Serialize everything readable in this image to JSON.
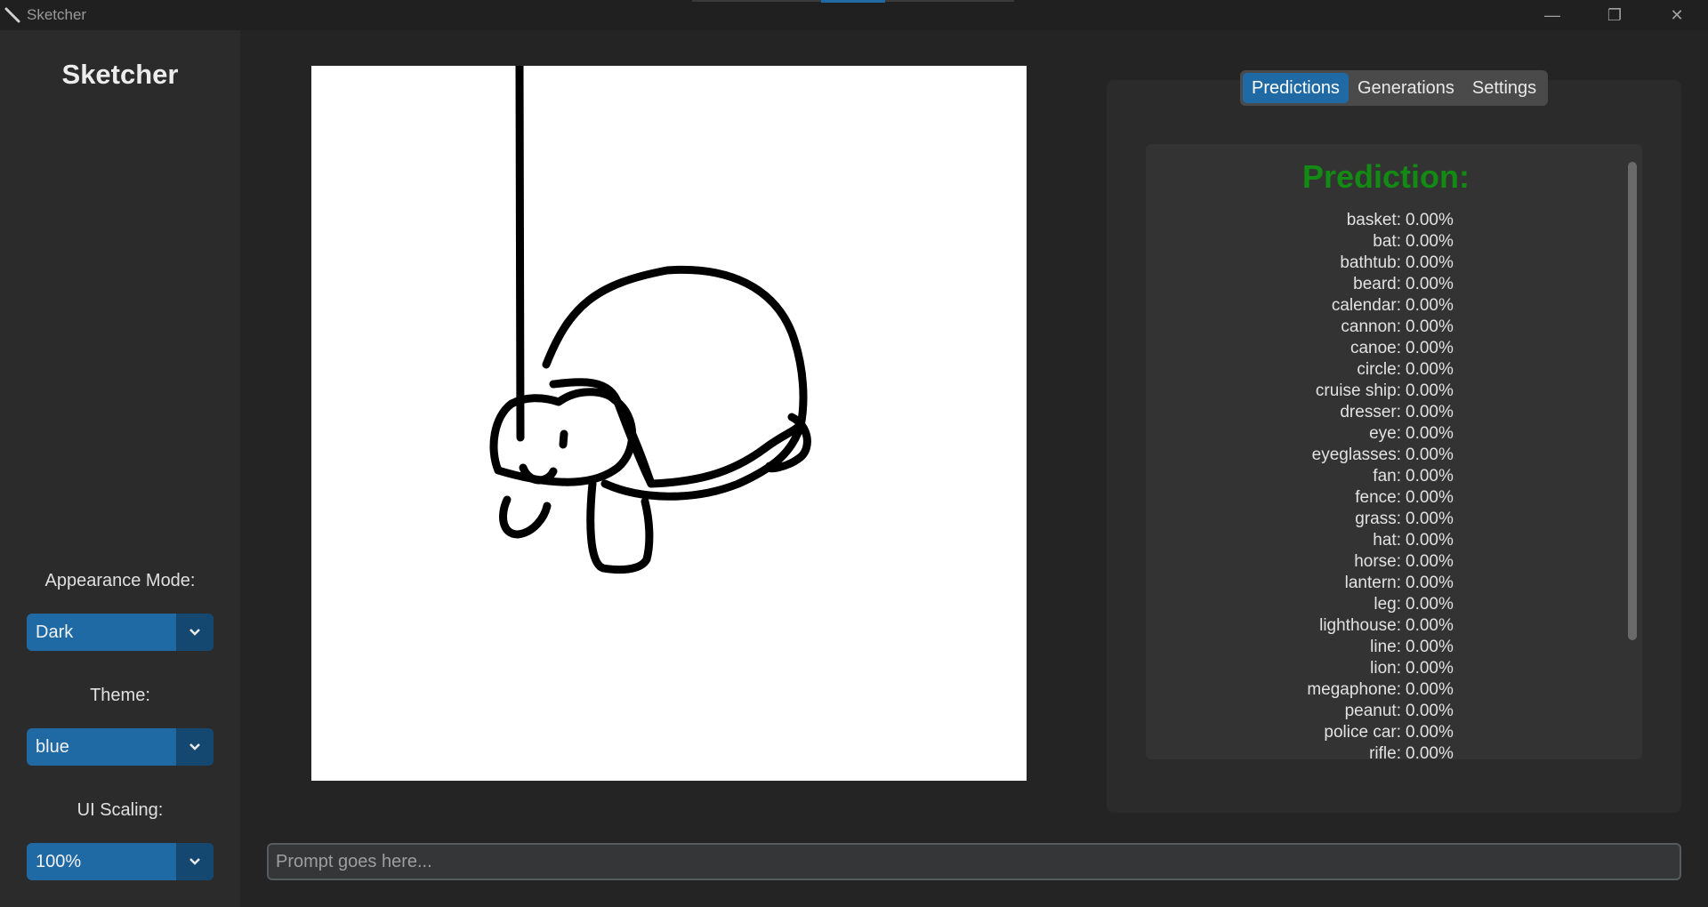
{
  "window": {
    "title": "Sketcher",
    "controls": {
      "minimize": "—",
      "restore": "❐",
      "close": "✕"
    }
  },
  "sidebar": {
    "logo": "Sketcher",
    "appearance": {
      "label": "Appearance Mode:",
      "value": "Dark"
    },
    "theme": {
      "label": "Theme:",
      "value": "blue"
    },
    "scaling": {
      "label": "UI Scaling:",
      "value": "100%"
    }
  },
  "tabs": [
    {
      "label": "Predictions",
      "active": true
    },
    {
      "label": "Generations",
      "active": false
    },
    {
      "label": "Settings",
      "active": false
    }
  ],
  "predictions": {
    "title": "Prediction:",
    "items": [
      {
        "name": "basket:",
        "value": "0.00%"
      },
      {
        "name": "bat:",
        "value": "0.00%"
      },
      {
        "name": "bathtub:",
        "value": "0.00%"
      },
      {
        "name": "beard:",
        "value": "0.00%"
      },
      {
        "name": "calendar:",
        "value": "0.00%"
      },
      {
        "name": "cannon:",
        "value": "0.00%"
      },
      {
        "name": "canoe:",
        "value": "0.00%"
      },
      {
        "name": "circle:",
        "value": "0.00%"
      },
      {
        "name": "cruise ship:",
        "value": "0.00%"
      },
      {
        "name": "dresser:",
        "value": "0.00%"
      },
      {
        "name": "eye:",
        "value": "0.00%"
      },
      {
        "name": "eyeglasses:",
        "value": "0.00%"
      },
      {
        "name": "fan:",
        "value": "0.00%"
      },
      {
        "name": "fence:",
        "value": "0.00%"
      },
      {
        "name": "grass:",
        "value": "0.00%"
      },
      {
        "name": "hat:",
        "value": "0.00%"
      },
      {
        "name": "horse:",
        "value": "0.00%"
      },
      {
        "name": "lantern:",
        "value": "0.00%"
      },
      {
        "name": "leg:",
        "value": "0.00%"
      },
      {
        "name": "lighthouse:",
        "value": "0.00%"
      },
      {
        "name": "line:",
        "value": "0.00%"
      },
      {
        "name": "lion:",
        "value": "0.00%"
      },
      {
        "name": "megaphone:",
        "value": "0.00%"
      },
      {
        "name": "peanut:",
        "value": "0.00%"
      },
      {
        "name": "police car:",
        "value": "0.00%"
      },
      {
        "name": "rifle:",
        "value": "0.00%"
      }
    ]
  },
  "prompt": {
    "placeholder": "Prompt goes here..."
  },
  "colors": {
    "accent": "#1f6aa5",
    "prediction_title": "#138a13",
    "background": "#242424"
  }
}
